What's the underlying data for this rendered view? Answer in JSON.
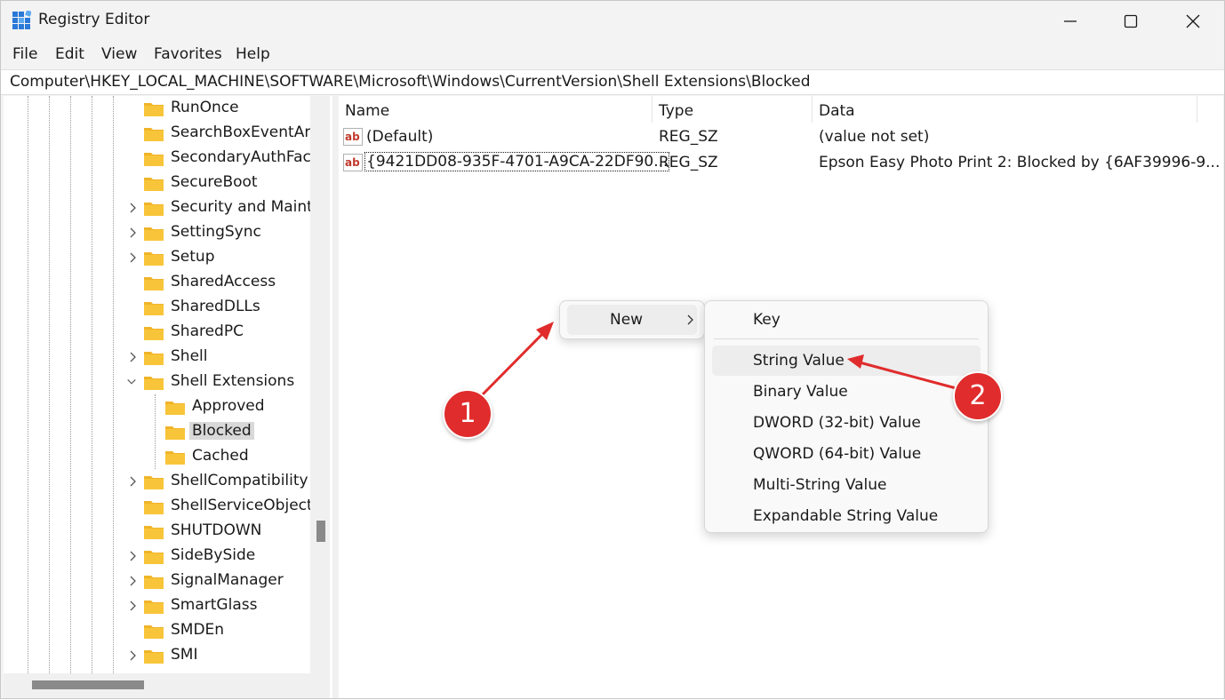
{
  "window": {
    "title": "Registry Editor"
  },
  "menu": [
    "File",
    "Edit",
    "View",
    "Favorites",
    "Help"
  ],
  "address": "Computer\\HKEY_LOCAL_MACHINE\\SOFTWARE\\Microsoft\\Windows\\CurrentVersion\\Shell Extensions\\Blocked",
  "tree": {
    "items": [
      {
        "label": "RunOnce"
      },
      {
        "label": "SearchBoxEventArg"
      },
      {
        "label": "SecondaryAuthFacto"
      },
      {
        "label": "SecureBoot"
      },
      {
        "label": "Security and Mainte"
      },
      {
        "label": "SettingSync"
      },
      {
        "label": "Setup"
      },
      {
        "label": "SharedAccess"
      },
      {
        "label": "SharedDLLs"
      },
      {
        "label": "SharedPC"
      },
      {
        "label": "Shell"
      },
      {
        "label": "Shell Extensions"
      },
      {
        "label": "Approved"
      },
      {
        "label": "Blocked"
      },
      {
        "label": "Cached"
      },
      {
        "label": "ShellCompatibility"
      },
      {
        "label": "ShellServiceObjectD"
      },
      {
        "label": "SHUTDOWN"
      },
      {
        "label": "SideBySide"
      },
      {
        "label": "SignalManager"
      },
      {
        "label": "SmartGlass"
      },
      {
        "label": "SMDEn"
      },
      {
        "label": "SMI"
      }
    ]
  },
  "list": {
    "columns": [
      "Name",
      "Type",
      "Data"
    ],
    "rows": [
      {
        "name": "(Default)",
        "type": "REG_SZ",
        "data": "(value not set)"
      },
      {
        "name": "{9421DD08-935F-4701-A9CA-22DF90...",
        "type": "REG_SZ",
        "data": "Epson Easy Photo Print 2: Blocked by {6AF39996-9..."
      }
    ]
  },
  "context_menu": {
    "new_label": "New"
  },
  "submenu": {
    "items": [
      "Key",
      "String Value",
      "Binary Value",
      "DWORD (32-bit) Value",
      "QWORD (64-bit) Value",
      "Multi-String Value",
      "Expandable String Value"
    ]
  },
  "annotations": {
    "badge1": "1",
    "badge2": "2"
  },
  "colors": {
    "folder": "#f8c53a",
    "annotation": "#e02c2c",
    "selection": "#d9d9d9"
  }
}
